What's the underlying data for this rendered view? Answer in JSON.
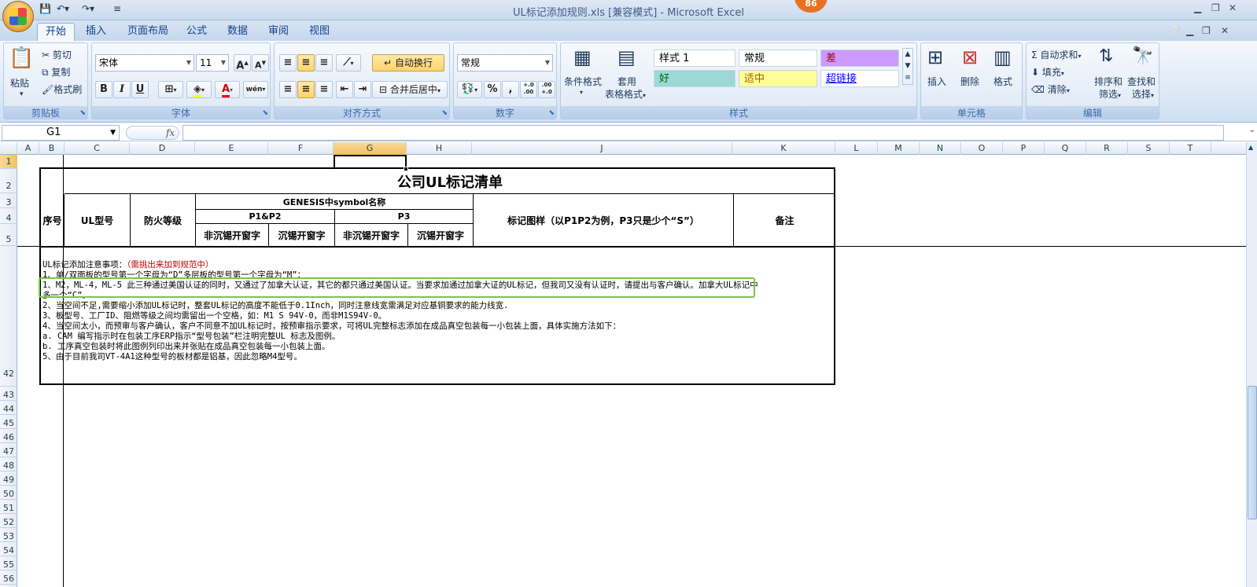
{
  "app": {
    "window_title": "UL标记添加规则.xls  [兼容模式] - Microsoft Excel",
    "badge": "86"
  },
  "tabs": [
    "开始",
    "插入",
    "页面布局",
    "公式",
    "数据",
    "审阅",
    "视图"
  ],
  "ribbon": {
    "clipboard": {
      "paste": "粘贴",
      "cut": "剪切",
      "copy": "复制",
      "format_painter": "格式刷",
      "label": "剪贴板"
    },
    "font": {
      "name": "宋体",
      "size": "11",
      "label": "字体",
      "bold": "B",
      "italic": "I",
      "underline": "U",
      "grow": "A",
      "shrink": "A",
      "font_color": "A",
      "phonetic": "wén"
    },
    "alignment": {
      "wrap": "自动换行",
      "merge": "合并后居中",
      "label": "对齐方式"
    },
    "number": {
      "format": "常规",
      "percent": "%",
      "comma": ",",
      "inc_decimal": "+.0 .00",
      "dec_decimal": ".00 +.0",
      "label": "数字"
    },
    "styles": {
      "conditional": "条件格式",
      "table_format_line1": "套用",
      "table_format_line2": "表格格式",
      "cells": [
        {
          "text": "样式 1",
          "bg": "#ffffff",
          "fg": "#000000"
        },
        {
          "text": "常规",
          "bg": "#ffffff",
          "fg": "#000000"
        },
        {
          "text": "差",
          "bg": "#cc99ff",
          "fg": "#9c0006"
        },
        {
          "text": "好",
          "bg": "#9bd8d6",
          "fg": "#006100"
        },
        {
          "text": "适中",
          "bg": "#ffff99",
          "fg": "#9c6500"
        },
        {
          "text": "超链接",
          "bg": "#ffffff",
          "fg": "#0000ff"
        }
      ],
      "label": "样式"
    },
    "cells": {
      "insert": "插入",
      "delete": "删除",
      "format": "格式",
      "label": "单元格"
    },
    "editing": {
      "autosum": "自动求和",
      "fill": "填充",
      "clear": "清除",
      "sort_line1": "排序和",
      "sort_line2": "筛选",
      "find_line1": "查找和",
      "find_line2": "选择",
      "label": "编辑"
    }
  },
  "formula_bar": {
    "name_box": "G1",
    "fx": "fx",
    "value": ""
  },
  "columns": [
    "A",
    "B",
    "C",
    "D",
    "E",
    "F",
    "G",
    "H",
    "J",
    "K",
    "L",
    "M",
    "N",
    "O",
    "P",
    "Q",
    "R",
    "S",
    "T"
  ],
  "rows": [
    "1",
    "2",
    "3",
    "4",
    "5",
    "42",
    "43",
    "44",
    "45",
    "46",
    "47",
    "48",
    "49",
    "50",
    "51",
    "52",
    "53",
    "54",
    "55",
    "56"
  ],
  "table": {
    "title": "公司UL标记清单",
    "h_no": "序号",
    "h_type": "UL型号",
    "h_fire": "防火等级",
    "h_genesis": "GENESIS中symbol名称",
    "h_p1p2": "P1&P2",
    "h_p3": "P3",
    "h_nosink1": "非沉锡开窗字",
    "h_sink1": "沉锡开窗字",
    "h_nosink2": "非沉锡开窗字",
    "h_sink2": "沉锡开窗字",
    "h_mark": "标记图样（以P1P2为例，P3只是少个“S”）",
    "h_remark": "备注",
    "notes": {
      "title": "UL标记添加注意事项：",
      "title_red": "（需挑出来加到规范中）",
      "n0": "1、单/双面板的型号第一个字母为“D”多层板的型号第一个字母为“M”：",
      "n1": "1、M2，ML-4，ML-5 此三种通过美国认证的同时，又通过了加拿大认证，其它的都只通过美国认证。当要求加通过加拿大证的UL标记，但我司又没有认证时，请提出与客户确认。加拿大UL标记中",
      "n1b": "多一个“C”。",
      "n2": "2、当空间不足,需要缩小添加UL标记时，整套UL标记的高度不能低于0.1Inch，同时注意线宽需满足对应基铜要求的能力线宽.",
      "n3": "3、板型号、工厂ID、阻燃等级之间均需留出一个空格，如：M1 S 94V-0，而非M1S94V-0。",
      "n4": "4、当空间太小，而预审与客户确认，客户不同意不加UL标记时，按预审指示要求，可将UL完整标志添加在成品真空包装每一小包装上面，具体实施方法如下：",
      "n4a": "a. CAM 编写指示时在包装工序ERP指示“型号包装”栏注明完整UL 标志及图例。",
      "n4b": "b. 工序真空包装时将此图例列印出来并张贴在成品真空包装每一小包装上面。",
      "n5": "5、由于目前我司VT-4A1这种型号的板材都是铝基，因此忽略M4型号。"
    }
  }
}
